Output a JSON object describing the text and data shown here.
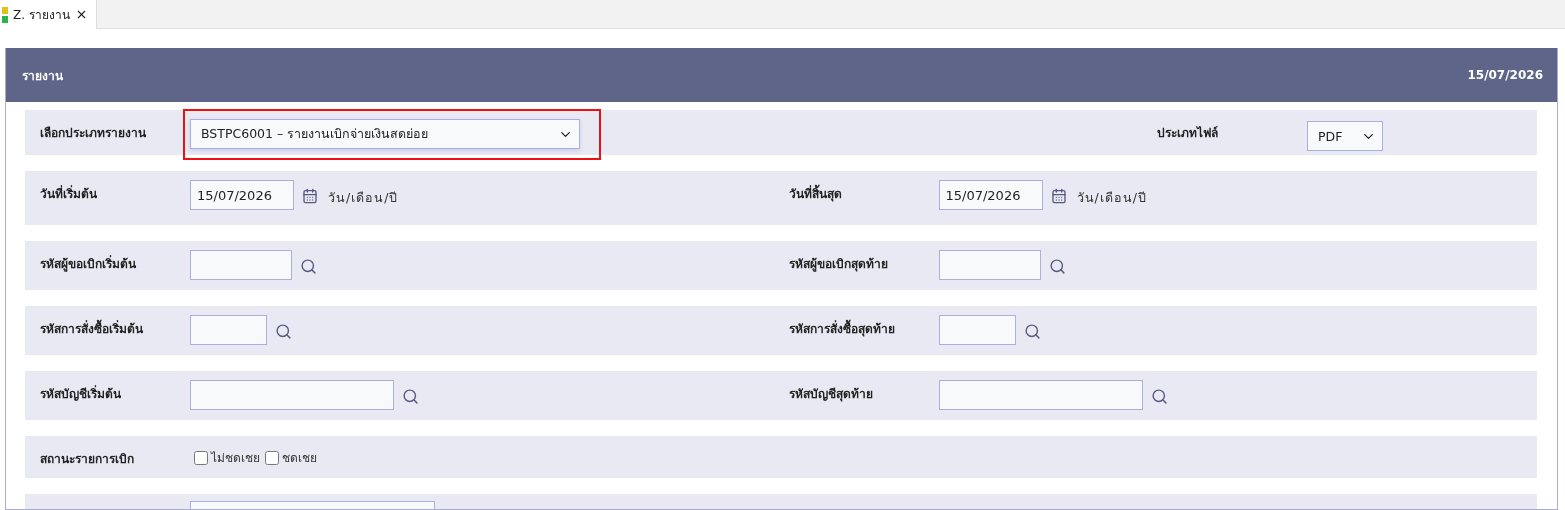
{
  "tab": {
    "label": "Z. รายงาน",
    "selected": true
  },
  "panel": {
    "title": "รายงาน",
    "date": "15/07/2026"
  },
  "rows": [
    {
      "kind": "select",
      "label": "เลือกประเภทรายงาน",
      "value": "BSTPC6001 – รายงานเบิกจ่ายเงินสดย่อย",
      "highlighted": true,
      "extra_label": "ประเภทไฟล์",
      "extra_value": "PDF"
    },
    {
      "kind": "date",
      "fields": [
        {
          "label": "วันที่เริ่มต้น",
          "value": "15/07/2026",
          "hint": "วัน/เดือน/ปี"
        },
        {
          "label": "วันที่สิ้นสุด",
          "value": "15/07/2026",
          "hint": "วัน/เดือน/ปี"
        }
      ]
    },
    {
      "kind": "lookup",
      "fields": [
        {
          "label": "รหัสผู้ขอเบิกเริ่มต้น"
        },
        {
          "label": "รหัสผู้ขอเบิกสุดท้าย"
        }
      ]
    },
    {
      "kind": "lookup",
      "fields": [
        {
          "label": "รหัสการสั่งซื้อเริ่มต้น"
        },
        {
          "label": "รหัสการสั่งซื้อสุดท้าย"
        }
      ]
    },
    {
      "kind": "lookup",
      "fields": [
        {
          "label": "รหัสบัญชีเริ่มต้น"
        },
        {
          "label": "รหัสบัญชีสุดท้าย"
        }
      ]
    },
    {
      "kind": "checks",
      "label": "สถานะรายการเบิก",
      "options": [
        {
          "label": "ไม่ชดเชย",
          "checked": false
        },
        {
          "label": "ชดเชย",
          "checked": false
        }
      ]
    },
    {
      "kind": "partial"
    }
  ]
}
